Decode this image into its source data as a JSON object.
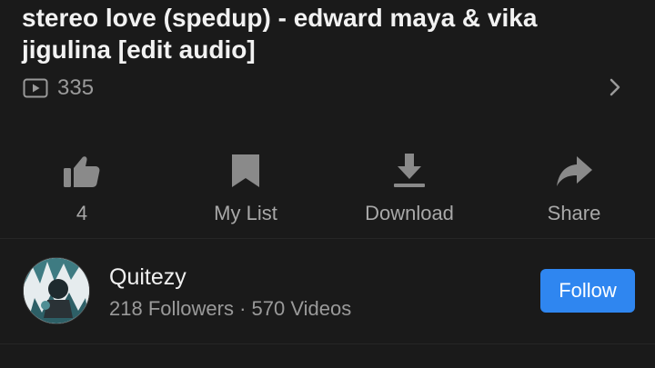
{
  "video": {
    "title": "stereo love (spedup) - edward maya & vika jigulina [edit audio]",
    "views": "335"
  },
  "actions": {
    "like": {
      "label": "4",
      "icon": "thumbs-up-icon"
    },
    "mylist": {
      "label": "My List",
      "icon": "bookmark-icon"
    },
    "download": {
      "label": "Download",
      "icon": "download-icon"
    },
    "share": {
      "label": "Share",
      "icon": "share-icon"
    }
  },
  "channel": {
    "name": "Quitezy",
    "meta": "218 Followers · 570 Videos",
    "follow_label": "Follow"
  },
  "colors": {
    "background": "#1a1a1a",
    "accent": "#2f86f0",
    "secondary_text": "#9a9a9a"
  }
}
